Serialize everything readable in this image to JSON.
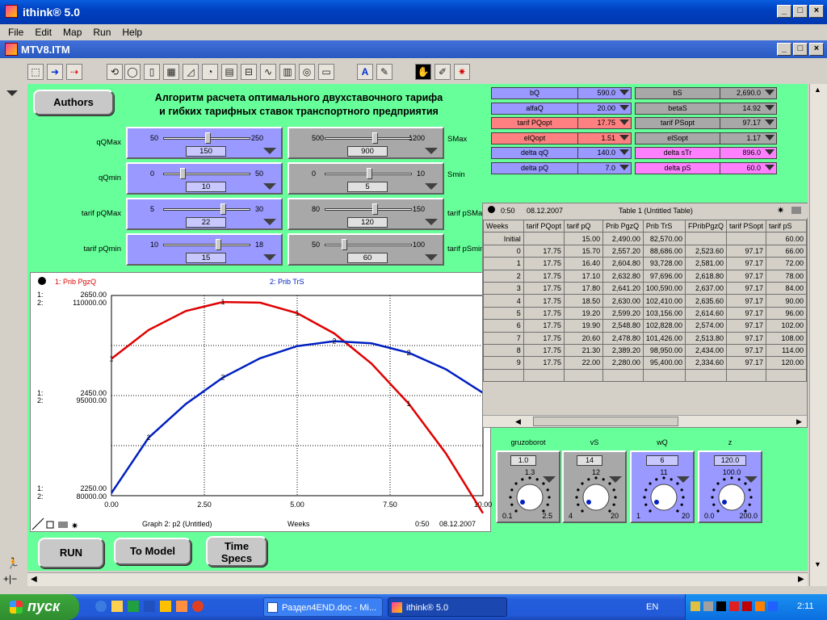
{
  "window": {
    "title": "ithink® 5.0",
    "doc_title": "MTV8.ITM"
  },
  "menu": [
    "File",
    "Edit",
    "Map",
    "Run",
    "Help"
  ],
  "buttons": {
    "authors": "Authors",
    "run": "RUN",
    "to_model": "To Model",
    "time_specs_1": "Time",
    "time_specs_2": "Specs"
  },
  "heading": {
    "line1": "Алгоритм расчета оптимального двухставочного тарифа",
    "line2": "и гибких тарифных ставок транспортного предприятия"
  },
  "sliders_left": [
    {
      "label": "qQMax",
      "min": "50",
      "max": "250",
      "value": "150",
      "frac": 0.5
    },
    {
      "label": "qQmin",
      "min": "0",
      "max": "50",
      "value": "10",
      "frac": 0.2
    },
    {
      "label": "tarif pQMax",
      "min": "5",
      "max": "30",
      "value": "22",
      "frac": 0.68
    },
    {
      "label": "tarif pQmin",
      "min": "10",
      "max": "18",
      "value": "15",
      "frac": 0.625
    }
  ],
  "sliders_right": [
    {
      "label": "SMax",
      "min": "500",
      "max": "1200",
      "value": "900",
      "frac": 0.571
    },
    {
      "label": "Smin",
      "min": "0",
      "max": "10",
      "value": "5",
      "frac": 0.5
    },
    {
      "label": "tarif pSMax",
      "min": "80",
      "max": "150",
      "value": "120",
      "frac": 0.571
    },
    {
      "label": "tarif pSmin",
      "min": "50",
      "max": "100",
      "value": "60",
      "frac": 0.2
    }
  ],
  "numboxes_left": [
    {
      "name": "bQ",
      "value": "590.0",
      "color": "#9999ff"
    },
    {
      "name": "alfaQ",
      "value": "20.00",
      "color": "#9999ff"
    },
    {
      "name": "tarif PQopt",
      "value": "17.75",
      "color": "#ff8080"
    },
    {
      "name": "elQopt",
      "value": "1.51",
      "color": "#ff8080"
    },
    {
      "name": "delta qQ",
      "value": "140.0",
      "color": "#9999ff"
    },
    {
      "name": "delta pQ",
      "value": "7.0",
      "color": "#9999ff"
    }
  ],
  "numboxes_right": [
    {
      "name": "bS",
      "value": "2,690.0",
      "color": "#a8a8a8"
    },
    {
      "name": "betaS",
      "value": "14.92",
      "color": "#a8a8a8"
    },
    {
      "name": "tarif PSopt",
      "value": "97.17",
      "color": "#a8a8a8"
    },
    {
      "name": "elSopt",
      "value": "1.17",
      "color": "#a8a8a8"
    },
    {
      "name": "delta sTr",
      "value": "896.0",
      "color": "#ff80ff"
    },
    {
      "name": "delta pS",
      "value": "60.0",
      "color": "#ff80ff"
    }
  ],
  "graph": {
    "legend1": "1: Prib PgzQ",
    "legend2": "2: Prib TrS",
    "y_top_1": "2650.00",
    "y_top_2": "110000.00",
    "y_mid_1": "2450.00",
    "y_mid_2": "95000.00",
    "y_bot_1": "2250.00",
    "y_bot_2": "80000.00",
    "x_ticks": [
      "0.00",
      "2.50",
      "5.00",
      "7.50",
      "10.00"
    ],
    "footer": "Graph 2: p2 (Untitled)",
    "xlabel": "Weeks",
    "time": "0:50",
    "date": "08.12.2007",
    "tag1": "1:",
    "tag2": "2:"
  },
  "chart_data": {
    "type": "line",
    "x": [
      0,
      1,
      2,
      3,
      4,
      5,
      6,
      7,
      8,
      9,
      10
    ],
    "series": [
      {
        "name": "1: Prib PgzQ",
        "axis": [
          2250,
          2650
        ],
        "color": "#e00000",
        "values": [
          2523.6,
          2581.0,
          2618.8,
          2637.0,
          2635.6,
          2614.6,
          2574.0,
          2513.8,
          2434.0,
          2334.6,
          2215.0
        ]
      },
      {
        "name": "2: Prib TrS",
        "axis": [
          80000,
          110000
        ],
        "color": "#0020c0",
        "values": [
          80400,
          88686,
          93728,
          97696,
          100590,
          102410,
          103156,
          102828,
          101426,
          98950,
          95400
        ]
      }
    ],
    "xlim": [
      0,
      10
    ],
    "xlabel": "Weeks",
    "grid": true
  },
  "table": {
    "time": "0:50",
    "date": "08.12.2007",
    "title": "Table 1 (Untitled Table)",
    "headers": [
      "Weeks",
      "tarif PQopt",
      "tarif pQ",
      "Prib PgzQ",
      "Prib TrS",
      "FPribPgzQ",
      "tarif PSopt",
      "tarif pS"
    ],
    "rows": [
      [
        "Initial",
        "",
        "15.00",
        "2,490.00",
        "82,570.00",
        "",
        "",
        "60.00"
      ],
      [
        "0",
        "17.75",
        "15.70",
        "2,557.20",
        "88,686.00",
        "2,523.60",
        "97.17",
        "66.00"
      ],
      [
        "1",
        "17.75",
        "16.40",
        "2,604.80",
        "93,728.00",
        "2,581.00",
        "97.17",
        "72.00"
      ],
      [
        "2",
        "17.75",
        "17.10",
        "2,632.80",
        "97,696.00",
        "2,618.80",
        "97.17",
        "78.00"
      ],
      [
        "3",
        "17.75",
        "17.80",
        "2,641.20",
        "100,590.00",
        "2,637.00",
        "97.17",
        "84.00"
      ],
      [
        "4",
        "17.75",
        "18.50",
        "2,630.00",
        "102,410.00",
        "2,635.60",
        "97.17",
        "90.00"
      ],
      [
        "5",
        "17.75",
        "19.20",
        "2,599.20",
        "103,156.00",
        "2,614.60",
        "97.17",
        "96.00"
      ],
      [
        "6",
        "17.75",
        "19.90",
        "2,548.80",
        "102,828.00",
        "2,574.00",
        "97.17",
        "102.00"
      ],
      [
        "7",
        "17.75",
        "20.60",
        "2,478.80",
        "101,426.00",
        "2,513.80",
        "97.17",
        "108.00"
      ],
      [
        "8",
        "17.75",
        "21.30",
        "2,389.20",
        "98,950.00",
        "2,434.00",
        "97.17",
        "114.00"
      ],
      [
        "9",
        "17.75",
        "22.00",
        "2,280.00",
        "95,400.00",
        "2,334.60",
        "97.17",
        "120.00"
      ]
    ]
  },
  "knobs": [
    {
      "label": "gruzoborot",
      "value": "1.0",
      "top": "1.3",
      "min": "0.1",
      "max": "2.5",
      "color": "gray"
    },
    {
      "label": "vS",
      "value": "14",
      "top": "12",
      "min": "4",
      "max": "20",
      "color": "gray"
    },
    {
      "label": "wQ",
      "value": "6",
      "top": "11",
      "min": "1",
      "max": "20",
      "color": "blue"
    },
    {
      "label": "z",
      "value": "120.0",
      "top": "100.0",
      "min": "0.0",
      "max": "200.0",
      "color": "blue"
    }
  ],
  "taskbar": {
    "start": "пуск",
    "tasks": [
      "Раздел4END.doc - Mi...",
      "ithink® 5.0"
    ],
    "lang": "EN",
    "clock": "2:11"
  }
}
